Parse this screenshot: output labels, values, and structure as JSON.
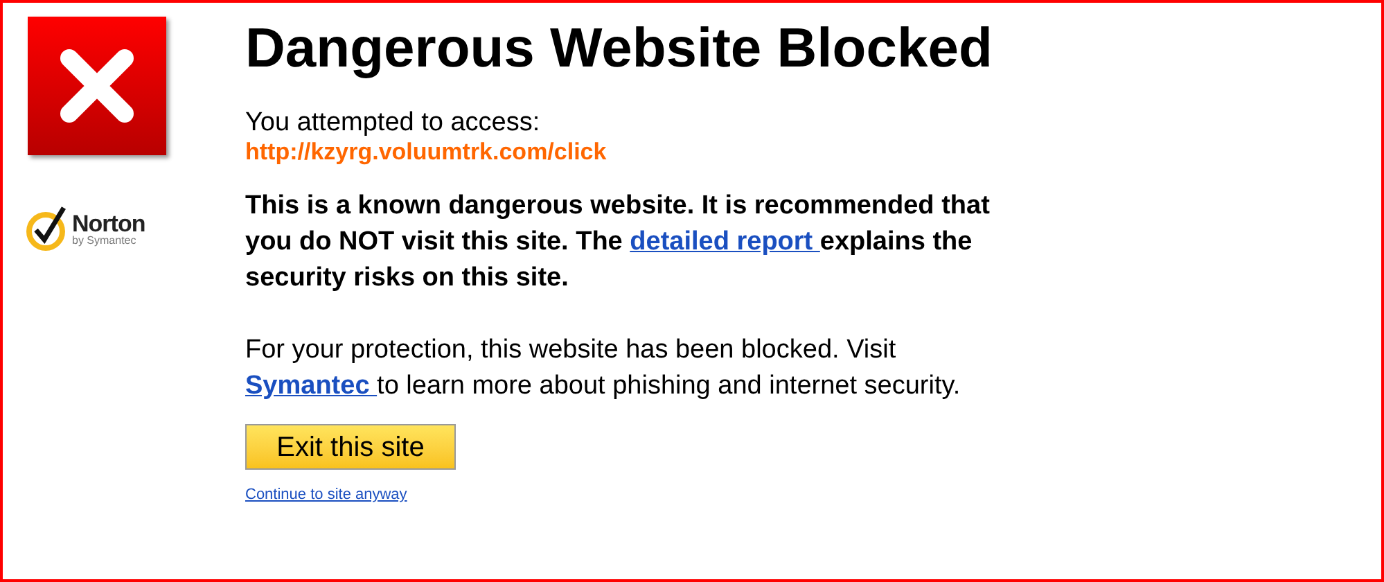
{
  "title": "Dangerous Website Blocked",
  "attempt": {
    "label": "You attempted to access:",
    "url": "http://kzyrg.voluumtrk.com/click"
  },
  "logo": {
    "name": "Norton",
    "tagline": "by Symantec"
  },
  "warning": {
    "before": "This is a known dangerous website. It is recommended that you do NOT visit this site. The ",
    "link": "detailed report ",
    "after": "explains the security risks on this site."
  },
  "protection": {
    "before": "For your protection, this website has been blocked. Visit ",
    "link": "Symantec ",
    "after": "to learn more about phishing and internet security."
  },
  "exit_button": "Exit this site",
  "continue_link": "Continue to site anyway"
}
